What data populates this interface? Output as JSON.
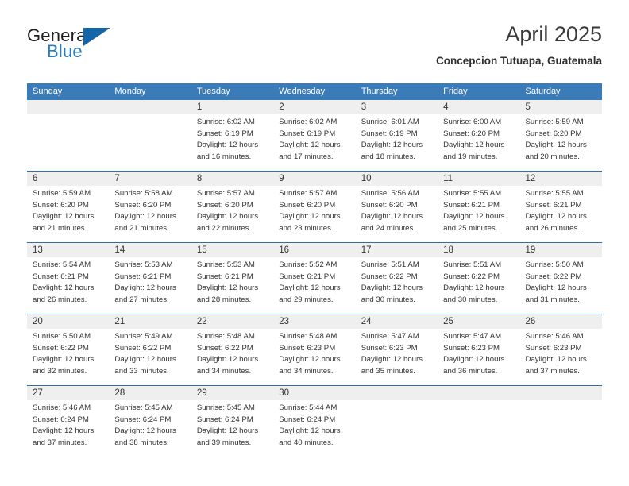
{
  "brand": {
    "name_part1": "General",
    "name_part2": "Blue",
    "triangle_icon": "triangle-icon",
    "color_dark": "#231f20",
    "color_blue": "#2b7bbd",
    "color_triangle": "#1466a8"
  },
  "header": {
    "title": "April 2025",
    "subtitle": "Concepcion Tutuapa, Guatemala"
  },
  "theme": {
    "header_blue": "#3a7cba",
    "row_divider_blue": "#2f6fae",
    "daynum_band_gray": "#efefef",
    "text": "#333333"
  },
  "weekdays": [
    "Sunday",
    "Monday",
    "Tuesday",
    "Wednesday",
    "Thursday",
    "Friday",
    "Saturday"
  ],
  "weeks": [
    [
      {
        "day": "",
        "lines": []
      },
      {
        "day": "",
        "lines": []
      },
      {
        "day": "1",
        "lines": [
          "Sunrise: 6:02 AM",
          "Sunset: 6:19 PM",
          "Daylight: 12 hours",
          "and 16 minutes."
        ]
      },
      {
        "day": "2",
        "lines": [
          "Sunrise: 6:02 AM",
          "Sunset: 6:19 PM",
          "Daylight: 12 hours",
          "and 17 minutes."
        ]
      },
      {
        "day": "3",
        "lines": [
          "Sunrise: 6:01 AM",
          "Sunset: 6:19 PM",
          "Daylight: 12 hours",
          "and 18 minutes."
        ]
      },
      {
        "day": "4",
        "lines": [
          "Sunrise: 6:00 AM",
          "Sunset: 6:20 PM",
          "Daylight: 12 hours",
          "and 19 minutes."
        ]
      },
      {
        "day": "5",
        "lines": [
          "Sunrise: 5:59 AM",
          "Sunset: 6:20 PM",
          "Daylight: 12 hours",
          "and 20 minutes."
        ]
      }
    ],
    [
      {
        "day": "6",
        "lines": [
          "Sunrise: 5:59 AM",
          "Sunset: 6:20 PM",
          "Daylight: 12 hours",
          "and 21 minutes."
        ]
      },
      {
        "day": "7",
        "lines": [
          "Sunrise: 5:58 AM",
          "Sunset: 6:20 PM",
          "Daylight: 12 hours",
          "and 21 minutes."
        ]
      },
      {
        "day": "8",
        "lines": [
          "Sunrise: 5:57 AM",
          "Sunset: 6:20 PM",
          "Daylight: 12 hours",
          "and 22 minutes."
        ]
      },
      {
        "day": "9",
        "lines": [
          "Sunrise: 5:57 AM",
          "Sunset: 6:20 PM",
          "Daylight: 12 hours",
          "and 23 minutes."
        ]
      },
      {
        "day": "10",
        "lines": [
          "Sunrise: 5:56 AM",
          "Sunset: 6:20 PM",
          "Daylight: 12 hours",
          "and 24 minutes."
        ]
      },
      {
        "day": "11",
        "lines": [
          "Sunrise: 5:55 AM",
          "Sunset: 6:21 PM",
          "Daylight: 12 hours",
          "and 25 minutes."
        ]
      },
      {
        "day": "12",
        "lines": [
          "Sunrise: 5:55 AM",
          "Sunset: 6:21 PM",
          "Daylight: 12 hours",
          "and 26 minutes."
        ]
      }
    ],
    [
      {
        "day": "13",
        "lines": [
          "Sunrise: 5:54 AM",
          "Sunset: 6:21 PM",
          "Daylight: 12 hours",
          "and 26 minutes."
        ]
      },
      {
        "day": "14",
        "lines": [
          "Sunrise: 5:53 AM",
          "Sunset: 6:21 PM",
          "Daylight: 12 hours",
          "and 27 minutes."
        ]
      },
      {
        "day": "15",
        "lines": [
          "Sunrise: 5:53 AM",
          "Sunset: 6:21 PM",
          "Daylight: 12 hours",
          "and 28 minutes."
        ]
      },
      {
        "day": "16",
        "lines": [
          "Sunrise: 5:52 AM",
          "Sunset: 6:21 PM",
          "Daylight: 12 hours",
          "and 29 minutes."
        ]
      },
      {
        "day": "17",
        "lines": [
          "Sunrise: 5:51 AM",
          "Sunset: 6:22 PM",
          "Daylight: 12 hours",
          "and 30 minutes."
        ]
      },
      {
        "day": "18",
        "lines": [
          "Sunrise: 5:51 AM",
          "Sunset: 6:22 PM",
          "Daylight: 12 hours",
          "and 30 minutes."
        ]
      },
      {
        "day": "19",
        "lines": [
          "Sunrise: 5:50 AM",
          "Sunset: 6:22 PM",
          "Daylight: 12 hours",
          "and 31 minutes."
        ]
      }
    ],
    [
      {
        "day": "20",
        "lines": [
          "Sunrise: 5:50 AM",
          "Sunset: 6:22 PM",
          "Daylight: 12 hours",
          "and 32 minutes."
        ]
      },
      {
        "day": "21",
        "lines": [
          "Sunrise: 5:49 AM",
          "Sunset: 6:22 PM",
          "Daylight: 12 hours",
          "and 33 minutes."
        ]
      },
      {
        "day": "22",
        "lines": [
          "Sunrise: 5:48 AM",
          "Sunset: 6:22 PM",
          "Daylight: 12 hours",
          "and 34 minutes."
        ]
      },
      {
        "day": "23",
        "lines": [
          "Sunrise: 5:48 AM",
          "Sunset: 6:23 PM",
          "Daylight: 12 hours",
          "and 34 minutes."
        ]
      },
      {
        "day": "24",
        "lines": [
          "Sunrise: 5:47 AM",
          "Sunset: 6:23 PM",
          "Daylight: 12 hours",
          "and 35 minutes."
        ]
      },
      {
        "day": "25",
        "lines": [
          "Sunrise: 5:47 AM",
          "Sunset: 6:23 PM",
          "Daylight: 12 hours",
          "and 36 minutes."
        ]
      },
      {
        "day": "26",
        "lines": [
          "Sunrise: 5:46 AM",
          "Sunset: 6:23 PM",
          "Daylight: 12 hours",
          "and 37 minutes."
        ]
      }
    ],
    [
      {
        "day": "27",
        "lines": [
          "Sunrise: 5:46 AM",
          "Sunset: 6:24 PM",
          "Daylight: 12 hours",
          "and 37 minutes."
        ]
      },
      {
        "day": "28",
        "lines": [
          "Sunrise: 5:45 AM",
          "Sunset: 6:24 PM",
          "Daylight: 12 hours",
          "and 38 minutes."
        ]
      },
      {
        "day": "29",
        "lines": [
          "Sunrise: 5:45 AM",
          "Sunset: 6:24 PM",
          "Daylight: 12 hours",
          "and 39 minutes."
        ]
      },
      {
        "day": "30",
        "lines": [
          "Sunrise: 5:44 AM",
          "Sunset: 6:24 PM",
          "Daylight: 12 hours",
          "and 40 minutes."
        ]
      },
      {
        "day": "",
        "lines": []
      },
      {
        "day": "",
        "lines": []
      },
      {
        "day": "",
        "lines": []
      }
    ]
  ]
}
